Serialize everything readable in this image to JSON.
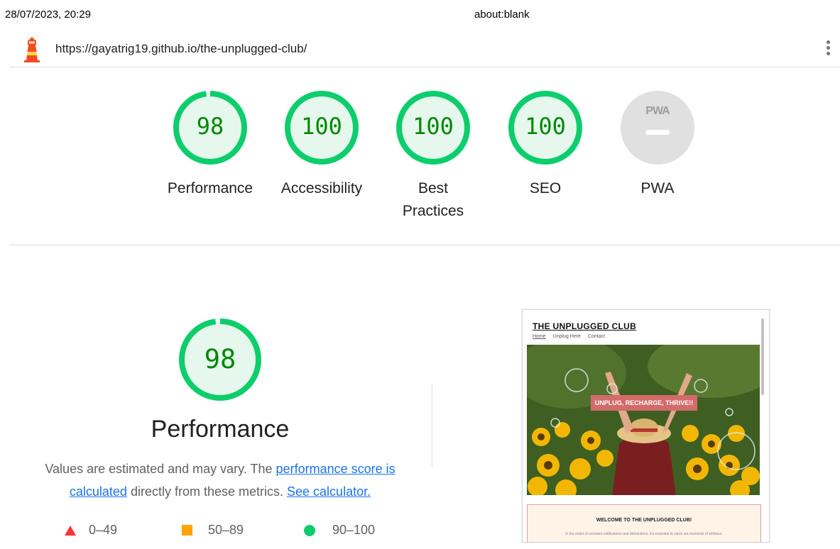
{
  "print": {
    "date": "28/07/2023, 20:29",
    "title": "about:blank"
  },
  "report": {
    "url": "https://gayatrig19.github.io/the-unplugged-club/"
  },
  "colors": {
    "pass": "#0cce6b",
    "pass_text": "#008800",
    "pass_fill": "#e6f8ee",
    "average": "#ffa400",
    "fail": "#ff3333",
    "link": "#1a73e8",
    "pwa_gray": "#e0e0e0"
  },
  "gauges": [
    {
      "score": "98",
      "score_value": 98,
      "label": "Performance"
    },
    {
      "score": "100",
      "score_value": 100,
      "label": "Accessibility"
    },
    {
      "score": "100",
      "score_value": 100,
      "label": "Best Practices"
    },
    {
      "score": "100",
      "score_value": 100,
      "label": "SEO"
    }
  ],
  "pwa": {
    "badge": "PWA",
    "label": "PWA",
    "icon": "pwa-dash-icon"
  },
  "performance": {
    "score": "98",
    "score_value": 98,
    "title": "Performance",
    "desc_pre": "Values are estimated and may vary. The ",
    "desc_link1": "performance score is calculated",
    "desc_mid": " directly from these metrics. ",
    "desc_link2": "See calculator."
  },
  "legend": [
    {
      "icon": "triangle-icon",
      "label": "0–49"
    },
    {
      "icon": "square-icon",
      "label": "50–89"
    },
    {
      "icon": "circle-icon",
      "label": "90–100"
    }
  ],
  "screenshot": {
    "site_title": "THE UNPLUGGED CLUB",
    "nav": [
      "Home",
      "Unplug Here",
      "Contact"
    ],
    "banner": "UNPLUG, RECHARGE, THRIVE!!",
    "welcome": "WELCOME TO THE UNPLUGGED CLUB!",
    "body_text": "In the midst of constant notifications and distractions, it's essential to carve out moments of stillness."
  }
}
